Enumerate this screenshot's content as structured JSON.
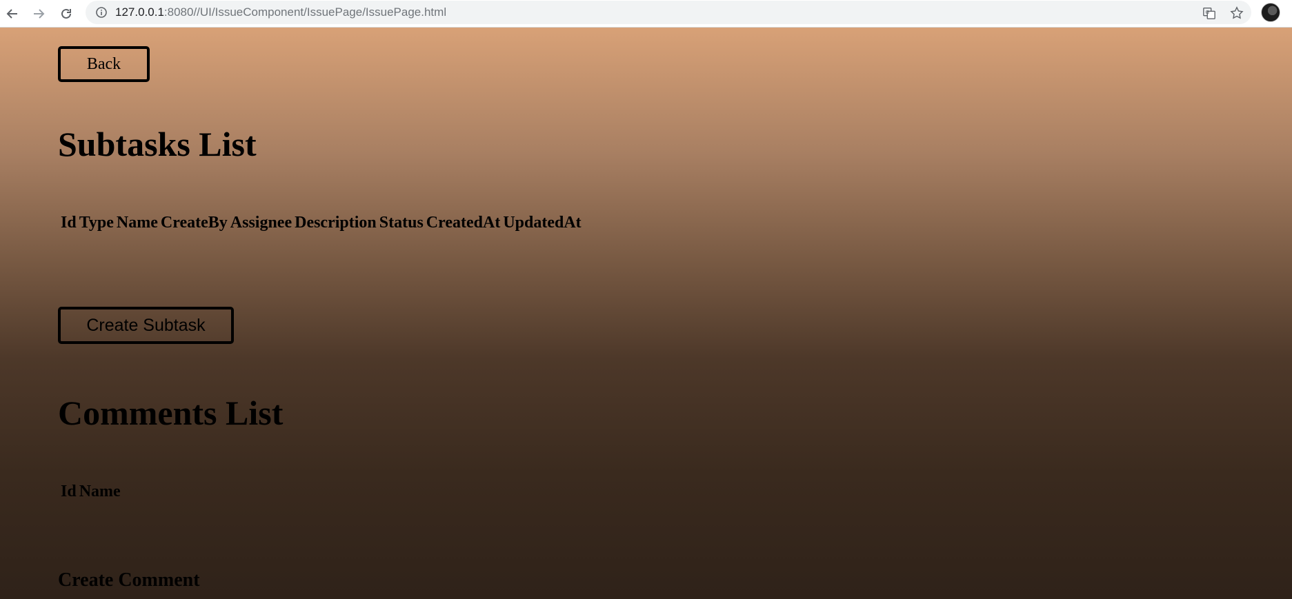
{
  "browser": {
    "url_host": "127.0.0.1",
    "url_rest": ":8080//UI/IssueComponent/IssuePage/IssuePage.html",
    "icons": [
      "back-arrow-icon",
      "forward-arrow-icon",
      "reload-icon",
      "info-icon",
      "translate-icon",
      "star-icon",
      "avatar"
    ]
  },
  "page": {
    "back_label": "Back",
    "subtasks": {
      "title": "Subtasks List",
      "columns": [
        "Id",
        "Type",
        "Name",
        "CreateBy",
        "Assignee",
        "Description",
        "Status",
        "CreatedAt",
        "UpdatedAt"
      ],
      "create_label": "Create Subtask"
    },
    "comments": {
      "title": "Comments List",
      "columns": [
        "Id",
        "Name"
      ],
      "create_heading": "Create Comment"
    }
  },
  "colors": {
    "gradient_top": "#d8a177",
    "gradient_bottom": "#2f2219",
    "text": "#000000"
  }
}
